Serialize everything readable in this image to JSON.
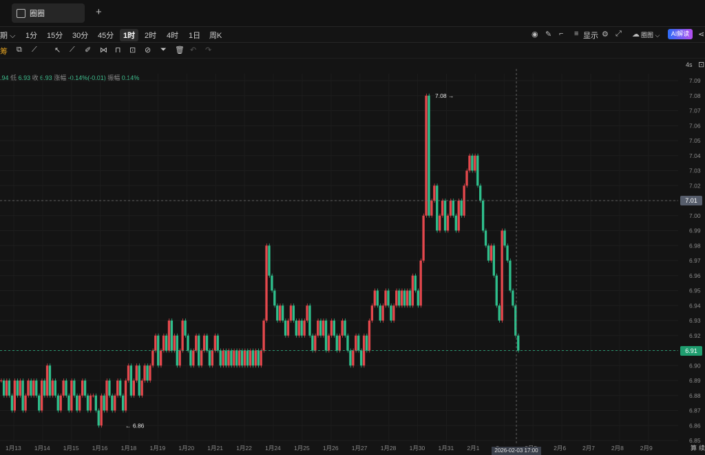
{
  "tab": {
    "title": "圈圈",
    "new_tab": "+"
  },
  "toolbar": {
    "period_label": "期",
    "timeframes": [
      "1分",
      "15分",
      "30分",
      "45分",
      "1时",
      "2时",
      "4时",
      "1日",
      "周K"
    ],
    "selected": "1时",
    "display_label": "显示",
    "chart_mode_label": "圈图",
    "ai_label": "AI解读"
  },
  "drawtools": {
    "first_label": "筹"
  },
  "info": {
    "open_partial": ".94",
    "low_label": "低",
    "low": "6.93",
    "close_label": "收",
    "close": "6.93",
    "change_label": "涨幅",
    "change": "-0.14%(-0.01)",
    "amp_label": "振幅",
    "amp": "0.14%"
  },
  "corner": {
    "refresh": "4s"
  },
  "colors": {
    "up": "#e5484d",
    "down": "#2fbf8c",
    "bg": "#141414",
    "grid": "#222"
  },
  "chart_data": {
    "type": "candlestick",
    "ylim": [
      6.85,
      7.09
    ],
    "y_ticks": [
      7.09,
      7.08,
      7.07,
      7.06,
      7.05,
      7.04,
      7.03,
      7.02,
      7.01,
      7.0,
      6.99,
      6.98,
      6.97,
      6.96,
      6.95,
      6.94,
      6.93,
      6.92,
      6.91,
      6.9,
      6.89,
      6.88,
      6.87,
      6.86,
      6.85
    ],
    "x_ticks": [
      "1月13",
      "1月14",
      "1月15",
      "1月16",
      "1月18",
      "1月19",
      "1月20",
      "1月21",
      "1月22",
      "1月24",
      "1月25",
      "1月26",
      "1月27",
      "1月28",
      "1月30",
      "1月31",
      "2月1",
      "2",
      "2月5",
      "2月6",
      "2月7",
      "2月8",
      "2月9"
    ],
    "high_annotation": "7.08",
    "low_annotation": "6.86",
    "crosshair_price": "7.01",
    "last_price": "6.91",
    "crosshair_time": "2026-02-03 17:00",
    "bottom_right_labels": [
      "算",
      "续"
    ],
    "closes": [
      6.89,
      6.88,
      6.89,
      6.88,
      6.87,
      6.89,
      6.88,
      6.89,
      6.87,
      6.88,
      6.89,
      6.88,
      6.89,
      6.88,
      6.87,
      6.89,
      6.88,
      6.9,
      6.88,
      6.89,
      6.88,
      6.87,
      6.88,
      6.89,
      6.88,
      6.87,
      6.89,
      6.88,
      6.87,
      6.88,
      6.89,
      6.88,
      6.87,
      6.88,
      6.88,
      6.87,
      6.86,
      6.88,
      6.87,
      6.89,
      6.88,
      6.87,
      6.88,
      6.89,
      6.88,
      6.87,
      6.89,
      6.9,
      6.88,
      6.89,
      6.9,
      6.88,
      6.89,
      6.9,
      6.89,
      6.9,
      6.91,
      6.92,
      6.9,
      6.91,
      6.92,
      6.91,
      6.93,
      6.91,
      6.92,
      6.9,
      6.91,
      6.93,
      6.92,
      6.91,
      6.9,
      6.91,
      6.92,
      6.9,
      6.91,
      6.92,
      6.91,
      6.9,
      6.91,
      6.92,
      6.91,
      6.9,
      6.91,
      6.9,
      6.91,
      6.9,
      6.91,
      6.9,
      6.91,
      6.9,
      6.91,
      6.9,
      6.91,
      6.9,
      6.91,
      6.9,
      6.91,
      6.93,
      6.98,
      6.96,
      6.95,
      6.94,
      6.93,
      6.94,
      6.93,
      6.92,
      6.93,
      6.94,
      6.93,
      6.92,
      6.93,
      6.92,
      6.93,
      6.94,
      6.92,
      6.91,
      6.92,
      6.93,
      6.92,
      6.93,
      6.91,
      6.92,
      6.93,
      6.92,
      6.91,
      6.92,
      6.93,
      6.92,
      6.91,
      6.9,
      6.91,
      6.92,
      6.91,
      6.9,
      6.92,
      6.91,
      6.93,
      6.94,
      6.95,
      6.94,
      6.93,
      6.94,
      6.95,
      6.94,
      6.93,
      6.94,
      6.95,
      6.94,
      6.95,
      6.94,
      6.95,
      6.94,
      6.96,
      6.95,
      6.94,
      6.97,
      7.0,
      7.08,
      7.0,
      7.01,
      7.02,
      6.99,
      7.0,
      7.01,
      6.99,
      7.0,
      7.01,
      7.0,
      6.99,
      7.01,
      7.0,
      7.02,
      7.03,
      7.04,
      7.03,
      7.04,
      7.02,
      7.01,
      6.99,
      6.98,
      6.97,
      6.98,
      6.96,
      6.94,
      6.93,
      6.99,
      6.98,
      6.97,
      6.95,
      6.94,
      6.92,
      6.91
    ]
  }
}
